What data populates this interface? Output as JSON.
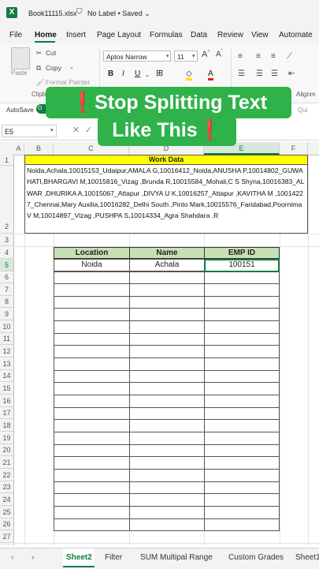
{
  "title_bar": {
    "app_icon": "X",
    "filename": "Book11115.xlsx",
    "label_icon": "shield-icon",
    "status": "No Label • Saved ⌄"
  },
  "menu": [
    "File",
    "Home",
    "Insert",
    "Page Layout",
    "Formulas",
    "Data",
    "Review",
    "View",
    "Automate"
  ],
  "ribbon": {
    "paste": "Paste",
    "cut": "Cut",
    "copy": "Copy",
    "format_painter": "Format Painter",
    "font_name": "Aptos Narrow",
    "font_size": "11",
    "clipboard_group": "Clipb",
    "alignment_group": "Alignm",
    "autosave": "AutoSave",
    "autosave_state": "O",
    "qui": "Qui"
  },
  "formula_bar": {
    "name_box": "E5"
  },
  "columns": [
    "A",
    "B",
    "C",
    "D",
    "E",
    "F"
  ],
  "rows": [
    "1",
    "2",
    "3",
    "4",
    "5",
    "6",
    "7",
    "8",
    "9",
    "10",
    "11",
    "12",
    "13",
    "14",
    "15",
    "16",
    "17",
    "18",
    "19",
    "20",
    "21",
    "22",
    "23",
    "24",
    "25",
    "26",
    "27"
  ],
  "work_data": {
    "title": "Work Data",
    "text": "Noida,Achala,10015153_Udaipur,AMALA G,10016412_Noida,ANUSHA P,10014802_GUWAHATI,BHARGAVI M,10015816_Vizag ,Brunda R,10015584_Mohali,C S Shyna,10016383_ALWAR ,DHURIKA A,10015067_Attapur ,DIVYA U K,10016257_Attapur ,KAVITHA M ,10014227_Chennai,Mary Auxilia,10016282_Delhi South ,Pinto Mark,10015576_Faridabad,Poornima V M,10014897_Vizag ,PUSHPA S,10014334_Agra Shahdara ,R"
  },
  "table": {
    "headers": [
      "Location",
      "Name",
      "EMP ID"
    ],
    "rows": [
      [
        "Noida",
        "Achala",
        "100151"
      ]
    ]
  },
  "banner": {
    "line1": "Stop Splitting Text",
    "line2": "Like This",
    "mark": "❗"
  },
  "sheet_tabs": [
    "Sheet2",
    "Filter",
    "SUM Multipal Range",
    "Custom Grades",
    "Sheet1"
  ],
  "colors": {
    "excel_green": "#107c41",
    "banner_green": "#2fb24a",
    "header_fill": "#c6e0b4",
    "title_fill": "#ffff00"
  }
}
